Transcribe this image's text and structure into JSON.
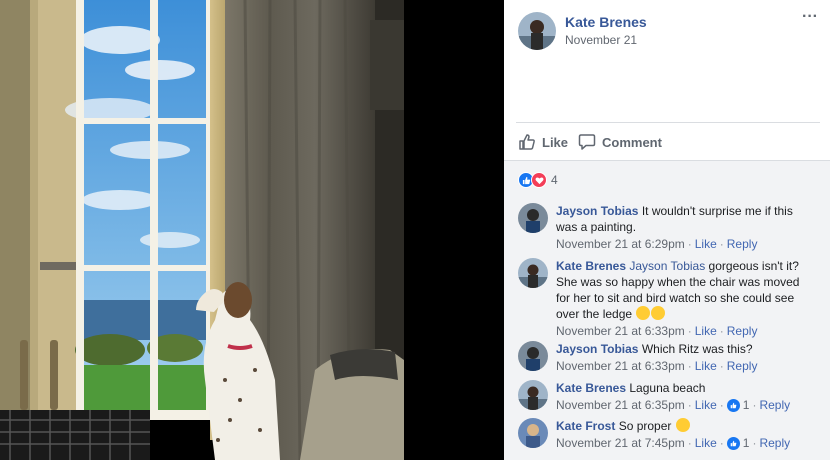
{
  "post": {
    "author": "Kate Brenes",
    "date": "November 21",
    "more_label": "···"
  },
  "actions": {
    "like_label": "Like",
    "comment_label": "Comment"
  },
  "reactions": {
    "count": "4",
    "types": [
      "like",
      "love"
    ]
  },
  "comments": [
    {
      "author": "Jayson Tobias",
      "tag": "",
      "text": "It wouldn't surprise me if this was a painting.",
      "time": "November 21 at 6:29pm",
      "like": "Like",
      "reply": "Reply",
      "reaction_count": ""
    },
    {
      "author": "Kate Brenes",
      "tag": "Jayson Tobias",
      "text": "gorgeous isn't it? She was so happy when the chair was moved for her to sit and bird watch so she could see over the ledge",
      "time": "November 21 at 6:33pm",
      "like": "Like",
      "reply": "Reply",
      "reaction_count": ""
    },
    {
      "author": "Jayson Tobias",
      "tag": "",
      "text": "Which Ritz was this?",
      "time": "November 21 at 6:33pm",
      "like": "Like",
      "reply": "Reply",
      "reaction_count": ""
    },
    {
      "author": "Kate Brenes",
      "tag": "",
      "text": "Laguna beach",
      "time": "November 21 at 6:35pm",
      "like": "Like",
      "reply": "Reply",
      "reaction_count": "1"
    },
    {
      "author": "Kate Frost",
      "tag": "",
      "text": "So proper",
      "time": "November 21 at 7:45pm",
      "like": "Like",
      "reply": "Reply",
      "reaction_count": "1"
    }
  ],
  "colors": {
    "link": "#385898",
    "meta": "#616770",
    "like_blue": "#1877f2",
    "love_red": "#f33e58",
    "comments_bg": "#f2f3f5"
  }
}
